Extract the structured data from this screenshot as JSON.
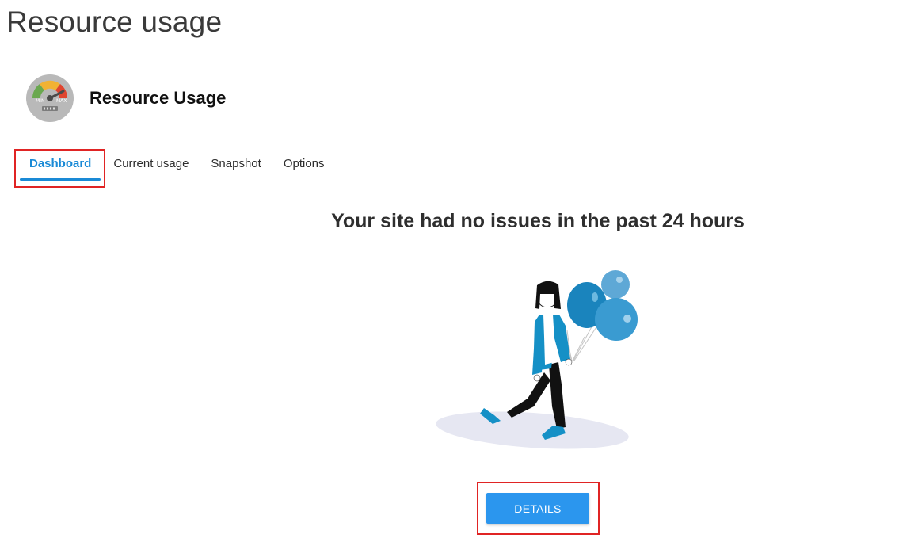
{
  "page": {
    "title": "Resource usage"
  },
  "app": {
    "name": "Resource Usage",
    "icon": "gauge-icon",
    "icon_labels": {
      "min": "MIN",
      "max": "MAX"
    }
  },
  "tabs": [
    {
      "label": "Dashboard",
      "active": true
    },
    {
      "label": "Current usage",
      "active": false
    },
    {
      "label": "Snapshot",
      "active": false
    },
    {
      "label": "Options",
      "active": false
    }
  ],
  "main": {
    "headline": "Your site had no issues in the past 24 hours",
    "illustration": "woman-with-balloons-illustration",
    "details_button_label": "DETAILS"
  },
  "colors": {
    "accent": "#1a8ad6",
    "button": "#2b96ee",
    "highlight": "#e02424"
  }
}
